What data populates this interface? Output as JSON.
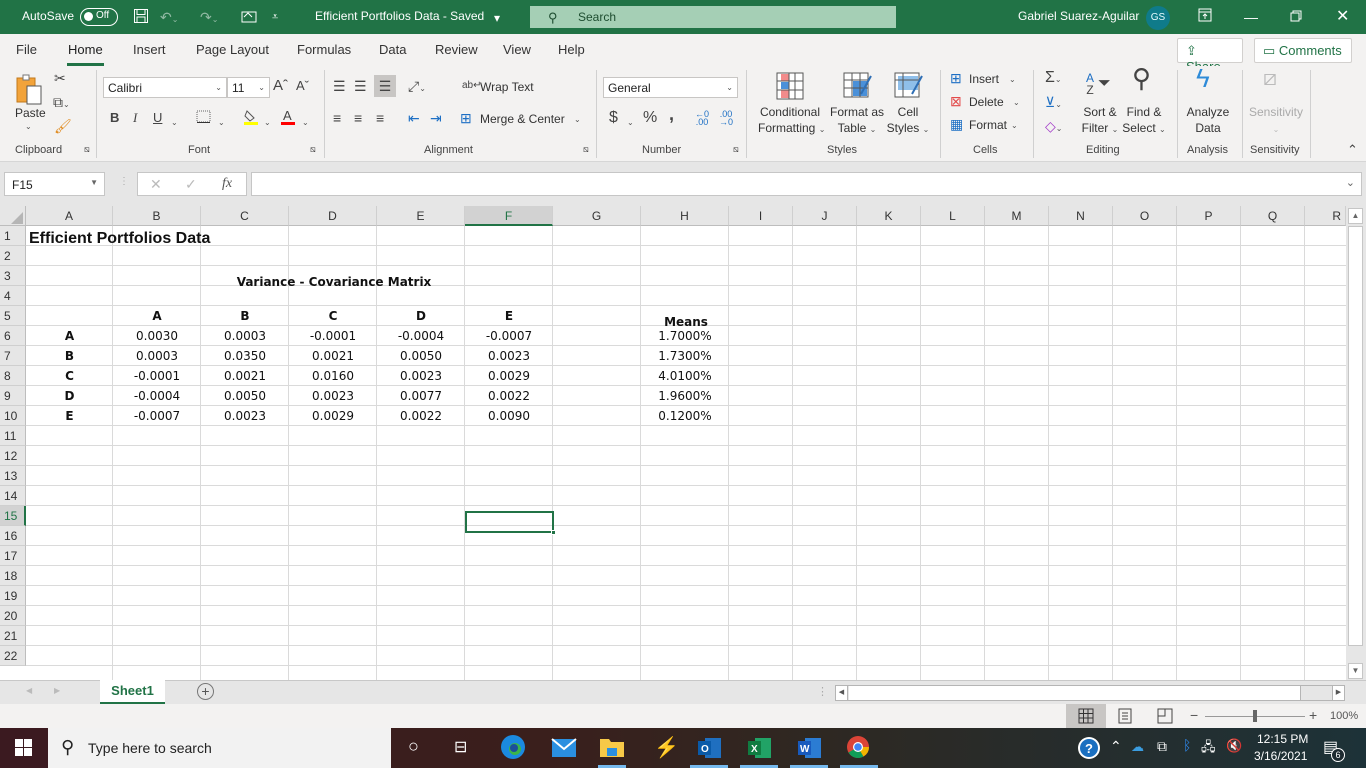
{
  "titlebar": {
    "autosave_label": "AutoSave",
    "autosave_state": "Off",
    "doc_title": "Efficient Portfolios Data  -  Saved",
    "search_placeholder": "Search",
    "user_name": "Gabriel Suarez-Aguilar",
    "user_initials": "GS"
  },
  "menu": {
    "tabs": [
      "File",
      "Home",
      "Insert",
      "Page Layout",
      "Formulas",
      "Data",
      "Review",
      "View",
      "Help"
    ],
    "active_tab": "Home",
    "share_label": "Share",
    "comments_label": "Comments"
  },
  "ribbon": {
    "clipboard": {
      "paste_label": "Paste",
      "group_label": "Clipboard"
    },
    "font": {
      "font_name": "Calibri",
      "font_size": "11",
      "group_label": "Font",
      "bold": "B",
      "italic": "I",
      "underline": "U",
      "highlight_color": "#ffff00",
      "font_color": "#ff0000"
    },
    "alignment": {
      "wrap_text": "Wrap Text",
      "merge_center": "Merge & Center",
      "group_label": "Alignment"
    },
    "number": {
      "format": "General",
      "group_label": "Number",
      "currency": "$",
      "percent": "%",
      "comma": ","
    },
    "styles": {
      "conditional_1": "Conditional",
      "conditional_2": "Formatting",
      "format_table_1": "Format as",
      "format_table_2": "Table",
      "cell_styles_1": "Cell",
      "cell_styles_2": "Styles",
      "group_label": "Styles"
    },
    "cells": {
      "insert": "Insert",
      "delete": "Delete",
      "format": "Format",
      "group_label": "Cells"
    },
    "editing": {
      "sort_1": "Sort &",
      "sort_2": "Filter",
      "find_1": "Find &",
      "find_2": "Select",
      "group_label": "Editing"
    },
    "analysis": {
      "analyze_1": "Analyze",
      "analyze_2": "Data",
      "group_label": "Analysis"
    },
    "sensitivity": {
      "label": "Sensitivity",
      "group_label": "Sensitivity"
    }
  },
  "formula_bar": {
    "name_box": "F15",
    "fx": "fx",
    "formula": ""
  },
  "sheet": {
    "columns": [
      "A",
      "B",
      "C",
      "D",
      "E",
      "F",
      "G",
      "H",
      "I",
      "J",
      "K",
      "L",
      "M",
      "N",
      "O",
      "P",
      "Q",
      "R"
    ],
    "selected_column": "F",
    "rows": [
      "1",
      "2",
      "3",
      "4",
      "5",
      "6",
      "7",
      "8",
      "9",
      "10",
      "11",
      "12",
      "13",
      "14",
      "15",
      "16",
      "17",
      "18",
      "19",
      "20",
      "21",
      "22"
    ],
    "selected_row": "15",
    "title": "Efficient Portfolios Data",
    "matrix_title": "Variance - Covariance Matrix",
    "matrix_col_headers": [
      "A",
      "B",
      "C",
      "D",
      "E"
    ],
    "matrix_row_headers": [
      "A",
      "B",
      "C",
      "D",
      "E"
    ],
    "matrix": [
      [
        "0.0030",
        "0.0003",
        "-0.0001",
        "-0.0004",
        "-0.0007"
      ],
      [
        "0.0003",
        "0.0350",
        "0.0021",
        "0.0050",
        "0.0023"
      ],
      [
        "-0.0001",
        "0.0021",
        "0.0160",
        "0.0023",
        "0.0029"
      ],
      [
        "-0.0004",
        "0.0050",
        "0.0023",
        "0.0077",
        "0.0022"
      ],
      [
        "-0.0007",
        "0.0023",
        "0.0029",
        "0.0022",
        "0.0090"
      ]
    ],
    "means_header": "Means",
    "means": [
      "1.7000%",
      "1.7300%",
      "4.0100%",
      "1.9600%",
      "0.1200%"
    ]
  },
  "sheet_tabs": {
    "tabs": [
      "Sheet1"
    ],
    "active": "Sheet1"
  },
  "status_bar": {
    "zoom": "100%",
    "zoom_level_percent": 100
  },
  "taskbar": {
    "search_placeholder": "Type here to search",
    "time": "12:15 PM",
    "date": "3/16/2021",
    "notification_count": "6"
  }
}
